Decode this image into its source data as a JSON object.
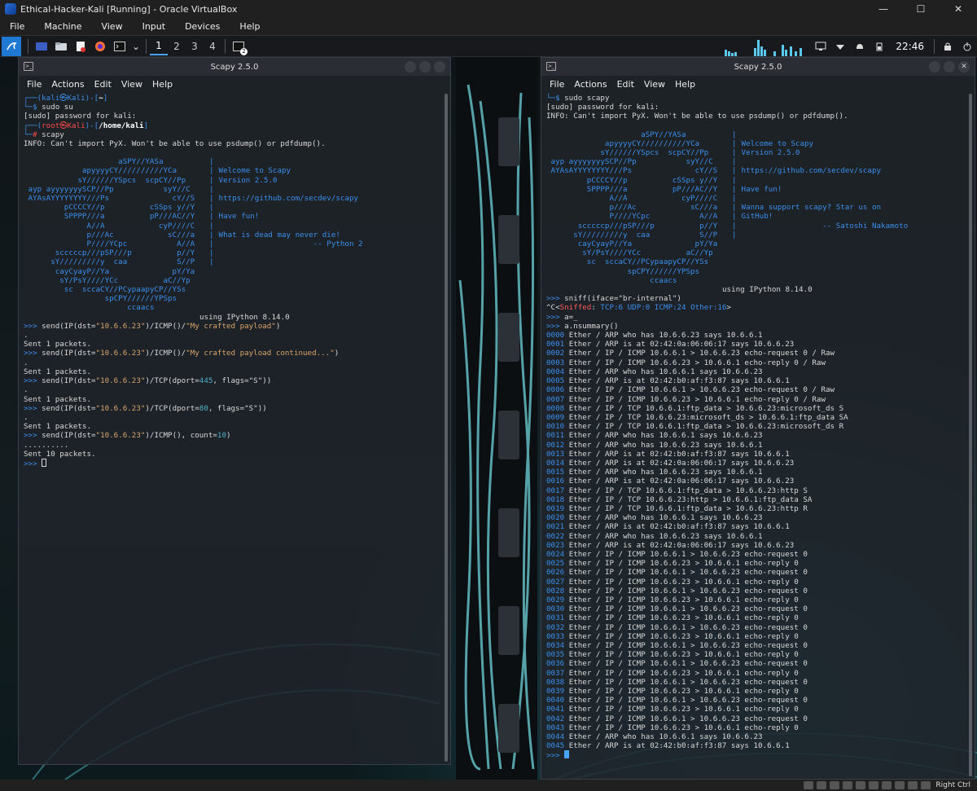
{
  "vb": {
    "title": "Ethical-Hacker-Kali [Running] - Oracle VirtualBox",
    "menu": [
      "File",
      "Machine",
      "View",
      "Input",
      "Devices",
      "Help"
    ],
    "host_key": "Right Ctrl"
  },
  "panel": {
    "workspaces": [
      "1",
      "2",
      "3",
      "4"
    ],
    "active_workspace": "1",
    "clock": "22:46",
    "badge": "2"
  },
  "left_term": {
    "title": "Scapy 2.5.0",
    "menu": [
      "File",
      "Actions",
      "Edit",
      "View",
      "Help"
    ],
    "prompt1": {
      "user": "kali",
      "host": "Kali",
      "dir": "~",
      "cmd": "sudo su"
    },
    "sudo_line": "[sudo] password for kali:",
    "prompt2": {
      "user": "root",
      "host": "Kali",
      "dir": "/home/kali",
      "cmd": "scapy"
    },
    "info": "INFO: Can't import PyX. Won't be able to use psdump() or pdfdump().",
    "banner_art": [
      "                     aSPY//YASa",
      "             apyyyyCY//////////YCa       ",
      "            sY//////YSpcs  scpCY//Pp     ",
      " ayp ayyyyyyySCP//Pp           syY//C    ",
      " AYAsAYYYYYYYY///Ps              cY//S   ",
      "         pCCCCY//p          cSSps y//Y   ",
      "         SPPPP///a          pP///AC//Y   ",
      "              A//A            cyP////C   ",
      "              p///Ac            sC///a   ",
      "              P////YCpc           A//A   ",
      "       scccccp///pSP///p          p//Y   ",
      "      sY/////////y  caa           S//P   ",
      "       cayCyayP//Ya              pY/Ya   ",
      "        sY/PsY////YCc          aC//Yp    ",
      "         sc  sccaCY//PCypaapyCP//YSs     ",
      "                  spCPY//////YPSps       ",
      "                       ccaacs            "
    ],
    "banner_info": [
      "",
      "Welcome to Scapy",
      "Version 2.5.0",
      "",
      "https://github.com/secdev/scapy",
      "",
      "Have fun!",
      "",
      "What is dead may never die!",
      "                     -- Python 2",
      "",
      "",
      "",
      "",
      "",
      "",
      ""
    ],
    "ipython": "using IPython 8.14.0",
    "session": [
      {
        "cmd_pre": "send(IP(dst=",
        "arg1": "\"10.6.6.23\"",
        "cmd_mid": ")/ICMP()/",
        "arg2": "\"My crafted payload\"",
        "cmd_post": ")",
        "out": [
          ".",
          "Sent 1 packets."
        ]
      },
      {
        "cmd_pre": "send(IP(dst=",
        "arg1": "\"10.6.6.23\"",
        "cmd_mid": ")/ICMP()/",
        "arg2": "\"My crafted payload continued...\"",
        "cmd_post": ")",
        "out": [
          ".",
          "Sent 1 packets."
        ]
      },
      {
        "cmd_pre": "send(IP(dst=",
        "arg1": "\"10.6.6.23\"",
        "cmd_mid": ")/TCP(dport=",
        "arg2": "445",
        "cmd_post": ", flags=\"S\"))",
        "out": [
          ".",
          "Sent 1 packets."
        ]
      },
      {
        "cmd_pre": "send(IP(dst=",
        "arg1": "\"10.6.6.23\"",
        "cmd_mid": ")/TCP(dport=",
        "arg2": "80",
        "cmd_post": ", flags=\"S\"))",
        "out": [
          ".",
          "Sent 1 packets."
        ]
      },
      {
        "cmd_pre": "send(IP(dst=",
        "arg1": "\"10.6.6.23\"",
        "cmd_mid": ")/ICMP(), count=",
        "arg2": "10",
        "cmd_post": ")",
        "out": [
          "..........",
          "Sent 10 packets."
        ]
      }
    ],
    "prompt": ">>>"
  },
  "right_term": {
    "title": "Scapy 2.5.0",
    "menu": [
      "File",
      "Actions",
      "Edit",
      "View",
      "Help"
    ],
    "top_cmd": "sudo scapy",
    "sudo_line": "[sudo] password for kali:",
    "info": "INFO: Can't import PyX. Won't be able to use psdump() or pdfdump().",
    "banner_art": [
      "                     aSPY//YASa",
      "             apyyyyCY//////////YCa       ",
      "            sY//////YSpcs  scpCY//Pp     ",
      " ayp ayyyyyyySCP//Pp           syY//C    ",
      " AYAsAYYYYYYYY///Ps              cY//S   ",
      "         pCCCCY//p          cSSps y//Y   ",
      "         SPPPP///a          pP///AC//Y   ",
      "              A//A            cyP////C   ",
      "              p///Ac            sC///a   ",
      "              P////YCpc           A//A   ",
      "       scccccp///pSP///p          p//Y   ",
      "      sY/////////y  caa           S//P   ",
      "       cayCyayP//Ya              pY/Ya   ",
      "        sY/PsY////YCc          aC//Yp    ",
      "         sc  sccaCY//PCypaapyCP//YSs     ",
      "                  spCPY//////YPSps       ",
      "                       ccaacs            "
    ],
    "banner_info": [
      "",
      "Welcome to Scapy",
      "Version 2.5.0",
      "",
      "https://github.com/secdev/scapy",
      "",
      "Have fun!",
      "",
      "Wanna support scapy? Star us on",
      "GitHub!",
      "                  -- Satoshi Nakamoto",
      "",
      "",
      "",
      "",
      "",
      ""
    ],
    "ipython": "using IPython 8.14.0",
    "sniff_cmd": "sniff(iface=\"br-internal\")",
    "sniffed": {
      "prefix": "^C<",
      "label": "Sniffed",
      "tcp": "TCP:6",
      "udp": "UDP:0",
      "icmp": "ICMP:24",
      "other": "Other:16",
      "suffix": ">"
    },
    "assign_cmd": "a=_",
    "summary_cmd": "a.nsummary()",
    "packets": [
      [
        "0000",
        "Ether / ARP who has 10.6.6.23 says 10.6.6.1"
      ],
      [
        "0001",
        "Ether / ARP is at 02:42:0a:06:06:17 says 10.6.6.23"
      ],
      [
        "0002",
        "Ether / IP / ICMP 10.6.6.1 > 10.6.6.23 echo-request 0 / Raw"
      ],
      [
        "0003",
        "Ether / IP / ICMP 10.6.6.23 > 10.6.6.1 echo-reply 0 / Raw"
      ],
      [
        "0004",
        "Ether / ARP who has 10.6.6.1 says 10.6.6.23"
      ],
      [
        "0005",
        "Ether / ARP is at 02:42:b0:af:f3:87 says 10.6.6.1"
      ],
      [
        "0006",
        "Ether / IP / ICMP 10.6.6.1 > 10.6.6.23 echo-request 0 / Raw"
      ],
      [
        "0007",
        "Ether / IP / ICMP 10.6.6.23 > 10.6.6.1 echo-reply 0 / Raw"
      ],
      [
        "0008",
        "Ether / IP / TCP 10.6.6.1:ftp_data > 10.6.6.23:microsoft_ds S"
      ],
      [
        "0009",
        "Ether / IP / TCP 10.6.6.23:microsoft_ds > 10.6.6.1:ftp_data SA"
      ],
      [
        "0010",
        "Ether / IP / TCP 10.6.6.1:ftp_data > 10.6.6.23:microsoft_ds R"
      ],
      [
        "0011",
        "Ether / ARP who has 10.6.6.1 says 10.6.6.23"
      ],
      [
        "0012",
        "Ether / ARP who has 10.6.6.23 says 10.6.6.1"
      ],
      [
        "0013",
        "Ether / ARP is at 02:42:b0:af:f3:87 says 10.6.6.1"
      ],
      [
        "0014",
        "Ether / ARP is at 02:42:0a:06:06:17 says 10.6.6.23"
      ],
      [
        "0015",
        "Ether / ARP who has 10.6.6.23 says 10.6.6.1"
      ],
      [
        "0016",
        "Ether / ARP is at 02:42:0a:06:06:17 says 10.6.6.23"
      ],
      [
        "0017",
        "Ether / IP / TCP 10.6.6.1:ftp_data > 10.6.6.23:http S"
      ],
      [
        "0018",
        "Ether / IP / TCP 10.6.6.23:http > 10.6.6.1:ftp_data SA"
      ],
      [
        "0019",
        "Ether / IP / TCP 10.6.6.1:ftp_data > 10.6.6.23:http R"
      ],
      [
        "0020",
        "Ether / ARP who has 10.6.6.1 says 10.6.6.23"
      ],
      [
        "0021",
        "Ether / ARP is at 02:42:b0:af:f3:87 says 10.6.6.1"
      ],
      [
        "0022",
        "Ether / ARP who has 10.6.6.23 says 10.6.6.1"
      ],
      [
        "0023",
        "Ether / ARP is at 02:42:0a:06:06:17 says 10.6.6.23"
      ],
      [
        "0024",
        "Ether / IP / ICMP 10.6.6.1 > 10.6.6.23 echo-request 0"
      ],
      [
        "0025",
        "Ether / IP / ICMP 10.6.6.23 > 10.6.6.1 echo-reply 0"
      ],
      [
        "0026",
        "Ether / IP / ICMP 10.6.6.1 > 10.6.6.23 echo-request 0"
      ],
      [
        "0027",
        "Ether / IP / ICMP 10.6.6.23 > 10.6.6.1 echo-reply 0"
      ],
      [
        "0028",
        "Ether / IP / ICMP 10.6.6.1 > 10.6.6.23 echo-request 0"
      ],
      [
        "0029",
        "Ether / IP / ICMP 10.6.6.23 > 10.6.6.1 echo-reply 0"
      ],
      [
        "0030",
        "Ether / IP / ICMP 10.6.6.1 > 10.6.6.23 echo-request 0"
      ],
      [
        "0031",
        "Ether / IP / ICMP 10.6.6.23 > 10.6.6.1 echo-reply 0"
      ],
      [
        "0032",
        "Ether / IP / ICMP 10.6.6.1 > 10.6.6.23 echo-request 0"
      ],
      [
        "0033",
        "Ether / IP / ICMP 10.6.6.23 > 10.6.6.1 echo-reply 0"
      ],
      [
        "0034",
        "Ether / IP / ICMP 10.6.6.1 > 10.6.6.23 echo-request 0"
      ],
      [
        "0035",
        "Ether / IP / ICMP 10.6.6.23 > 10.6.6.1 echo-reply 0"
      ],
      [
        "0036",
        "Ether / IP / ICMP 10.6.6.1 > 10.6.6.23 echo-request 0"
      ],
      [
        "0037",
        "Ether / IP / ICMP 10.6.6.23 > 10.6.6.1 echo-reply 0"
      ],
      [
        "0038",
        "Ether / IP / ICMP 10.6.6.1 > 10.6.6.23 echo-request 0"
      ],
      [
        "0039",
        "Ether / IP / ICMP 10.6.6.23 > 10.6.6.1 echo-reply 0"
      ],
      [
        "0040",
        "Ether / IP / ICMP 10.6.6.1 > 10.6.6.23 echo-request 0"
      ],
      [
        "0041",
        "Ether / IP / ICMP 10.6.6.23 > 10.6.6.1 echo-reply 0"
      ],
      [
        "0042",
        "Ether / IP / ICMP 10.6.6.1 > 10.6.6.23 echo-request 0"
      ],
      [
        "0043",
        "Ether / IP / ICMP 10.6.6.23 > 10.6.6.1 echo-reply 0"
      ],
      [
        "0044",
        "Ether / ARP who has 10.6.6.1 says 10.6.6.23"
      ],
      [
        "0045",
        "Ether / ARP is at 02:42:b0:af:f3:87 says 10.6.6.1"
      ]
    ],
    "prompt": ">>>"
  },
  "colors": {
    "accent": "#3b8eea",
    "prompt_red": "#ff4b4b",
    "string": "#d9a36a",
    "number": "#4fb0c6"
  }
}
